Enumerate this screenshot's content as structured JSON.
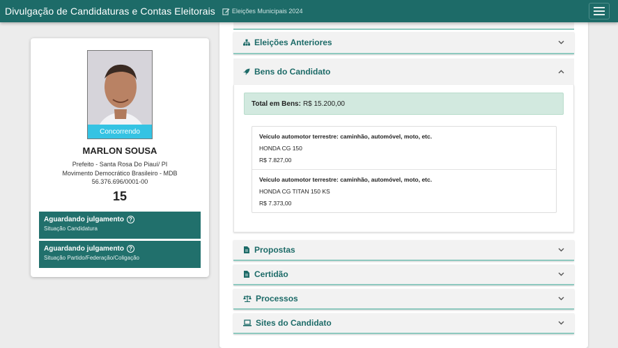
{
  "header": {
    "title": "Divulgação de Candidaturas e Contas Eleitorais",
    "election": "Eleições Municipais 2024"
  },
  "candidate": {
    "status_tag": "Concorrendo",
    "name": "MARLON SOUSA",
    "office": "Prefeito - Santa Rosa Do Piauí/ PI",
    "party": "Movimento Democrático Brasileiro - MDB",
    "cnpj": "56.376.696/0001-00",
    "number": "15",
    "situations": [
      {
        "title": "Aguardando julgamento",
        "subtitle": "Situação Candidatura"
      },
      {
        "title": "Aguardando julgamento",
        "subtitle": "Situação Partido/Federação/Coligação"
      }
    ]
  },
  "sections": {
    "previous_elections": "Eleições Anteriores",
    "assets": "Bens do Candidato",
    "proposals": "Propostas",
    "certificate": "Certidão",
    "processes": "Processos",
    "websites": "Sites do Candidato"
  },
  "assets": {
    "total_label": "Total em Bens:",
    "total_value": "R$ 15.200,00",
    "items": [
      {
        "type": "Veículo automotor terrestre: caminhão, automóvel, moto, etc.",
        "description": "HONDA CG 150",
        "value": "R$ 7.827,00"
      },
      {
        "type": "Veículo automotor terrestre: caminhão, automóvel, moto, etc.",
        "description": "HONDA CG TITAN 150 KS",
        "value": "R$ 7.373,00"
      }
    ]
  },
  "colors": {
    "brand": "#1d6b68",
    "status_tag": "#35c3e3",
    "situation_box": "#21706c",
    "total_box": "#d2e9df"
  }
}
